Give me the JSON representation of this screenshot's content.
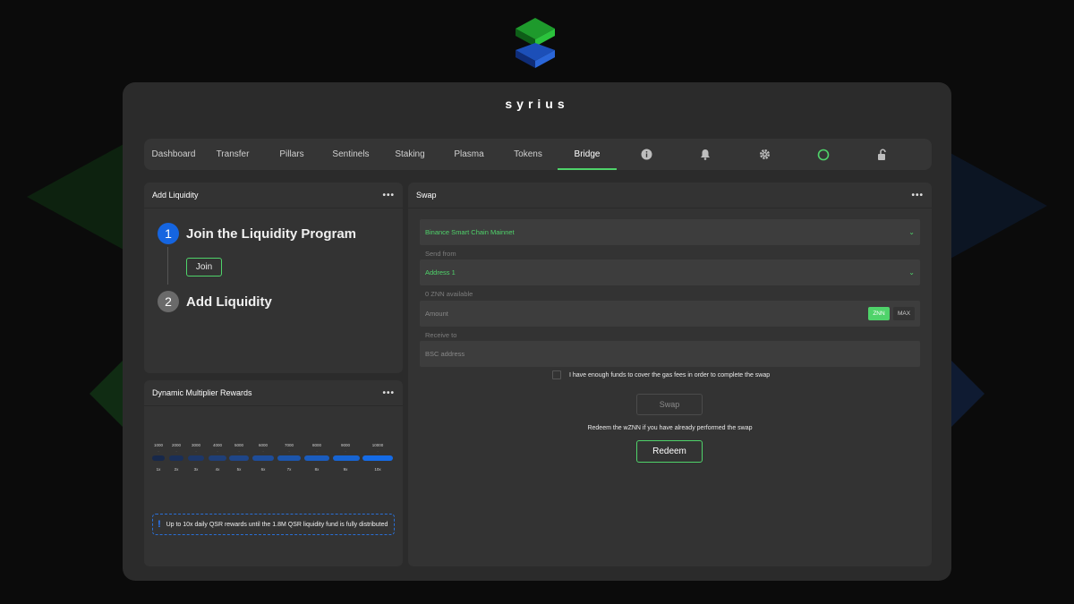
{
  "app": {
    "title": "syrius"
  },
  "nav": {
    "tabs": [
      {
        "label": "Dashboard"
      },
      {
        "label": "Transfer"
      },
      {
        "label": "Pillars"
      },
      {
        "label": "Sentinels"
      },
      {
        "label": "Staking"
      },
      {
        "label": "Plasma"
      },
      {
        "label": "Tokens"
      },
      {
        "label": "Bridge",
        "active": true
      }
    ],
    "icons": [
      "info-icon",
      "bell-icon",
      "gear-icon",
      "status-ring-icon",
      "unlock-icon"
    ],
    "accent": "#4fd36a"
  },
  "add_liquidity": {
    "title": "Add Liquidity",
    "menu": "•••",
    "steps": [
      {
        "number": "1",
        "title": "Join the Liquidity Program",
        "color": "#1565e0"
      },
      {
        "number": "2",
        "title": "Add Liquidity",
        "color": "#6a6a6a"
      }
    ],
    "join_label": "Join"
  },
  "multiplier": {
    "title": "Dynamic Multiplier Rewards",
    "menu": "•••",
    "levels": [
      {
        "top": "1000",
        "bottom": "1x"
      },
      {
        "top": "2000",
        "bottom": "2x"
      },
      {
        "top": "3000",
        "bottom": "3x"
      },
      {
        "top": "4000",
        "bottom": "4x"
      },
      {
        "top": "5000",
        "bottom": "5x"
      },
      {
        "top": "6000",
        "bottom": "6x"
      },
      {
        "top": "7000",
        "bottom": "7x"
      },
      {
        "top": "8000",
        "bottom": "8x"
      },
      {
        "top": "9000",
        "bottom": "9x"
      },
      {
        "top": "10000",
        "bottom": "10x"
      }
    ],
    "notice_icon": "!",
    "notice": "Up to 10x daily QSR rewards until the 1.8M QSR liquidity fund is fully distributed"
  },
  "swap": {
    "title": "Swap",
    "menu": "•••",
    "network": "Binance Smart Chain Mainnet",
    "send_from_label": "Send from",
    "address": "Address 1",
    "available": "0 ZNN available",
    "amount_placeholder": "Amount",
    "znn_label": "ZNN",
    "max_label": "MAX",
    "receive_label": "Receive to",
    "bsc_placeholder": "BSC address",
    "checkbox_label": "I have enough funds to cover the gas fees in order to complete the swap",
    "swap_label": "Swap",
    "redeem_note": "Redeem the wZNN if you have already performed the swap",
    "redeem_label": "Redeem"
  }
}
